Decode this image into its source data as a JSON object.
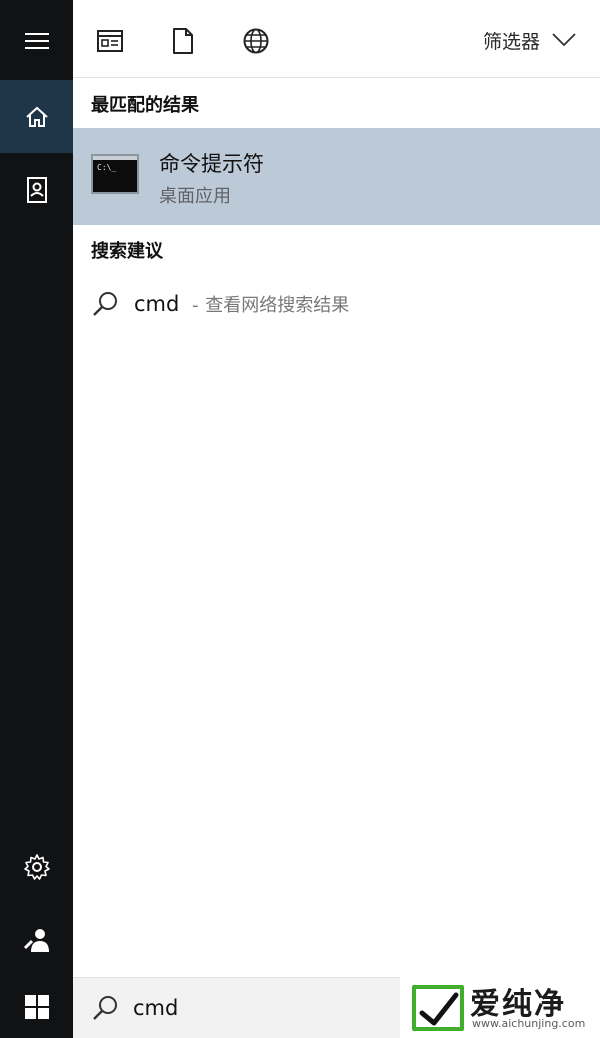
{
  "rail": {
    "icons": [
      "menu-icon",
      "home-icon",
      "notebook-icon",
      "gear-icon",
      "person-icon",
      "windows-icon"
    ]
  },
  "toolbar": {
    "icons": [
      "app-window-icon",
      "document-icon",
      "globe-icon"
    ],
    "filter_label": "筛选器"
  },
  "best_match": {
    "heading": "最匹配的结果",
    "icon_prompt": "C:\\_",
    "title": "命令提示符",
    "subtitle": "桌面应用"
  },
  "suggestions": {
    "heading": "搜索建议",
    "items": [
      {
        "term": "cmd",
        "separator": "-",
        "hint": "查看网络搜索结果"
      }
    ]
  },
  "search": {
    "value": "cmd"
  },
  "watermark": {
    "text": "爱纯净",
    "url": "www.aichunjing.com"
  },
  "colors": {
    "rail_bg": "#111214",
    "rail_active": "#1f3548",
    "selected_bg": "#bccad8",
    "search_bg": "#f2f2f2",
    "watermark_green": "#3fae2a"
  }
}
